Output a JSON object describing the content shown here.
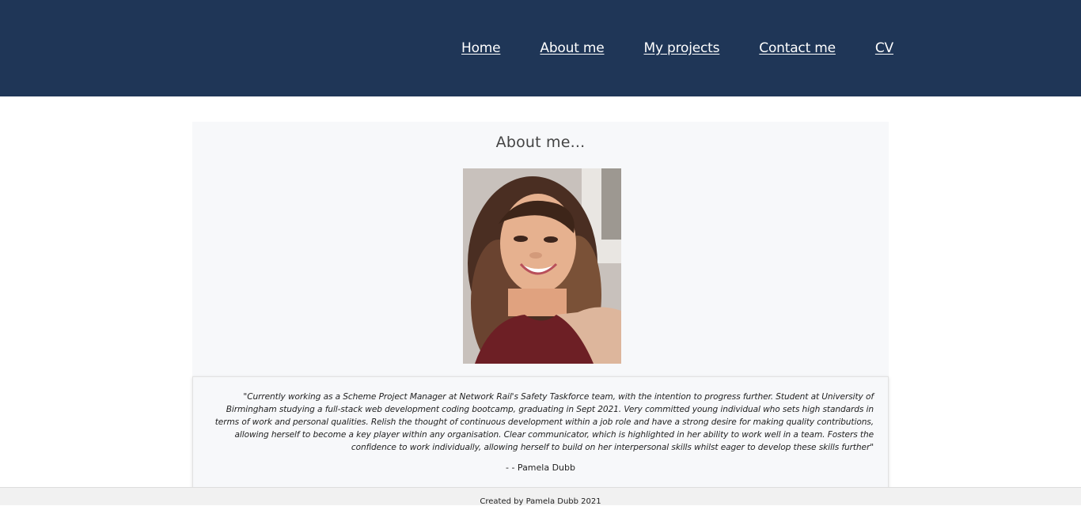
{
  "nav": {
    "items": [
      "Home",
      "About me",
      "My projects",
      "Contact me",
      "CV"
    ]
  },
  "about": {
    "title": "About me...",
    "photo_alt": "portrait-photo"
  },
  "quote": {
    "text": "\"Currently working as a Scheme Project Manager at Network Rail's Safety Taskforce team, with the intention to progress further. Student at University of Birmingham studying a full-stack web development coding bootcamp, graduating in Sept 2021. Very committed young individual who sets high standards in terms of work and personal qualities. Relish the thought of continuous development within a job role and have a strong desire for making quality contributions, allowing herself to become a key player within any organisation. Clear communicator, which is highlighted in her ability to work well in a team. Fosters the confidence to work individually, allowing herself to build on her interpersonal skills whilst eager to develop these skills further\"",
    "author": "- - Pamela Dubb"
  },
  "footer": {
    "text": "Created by Pamela Dubb 2021"
  },
  "colors": {
    "header_bg": "#1f3657",
    "card_bg": "#f7f8fa",
    "footer_bg": "#f1f1f1"
  }
}
